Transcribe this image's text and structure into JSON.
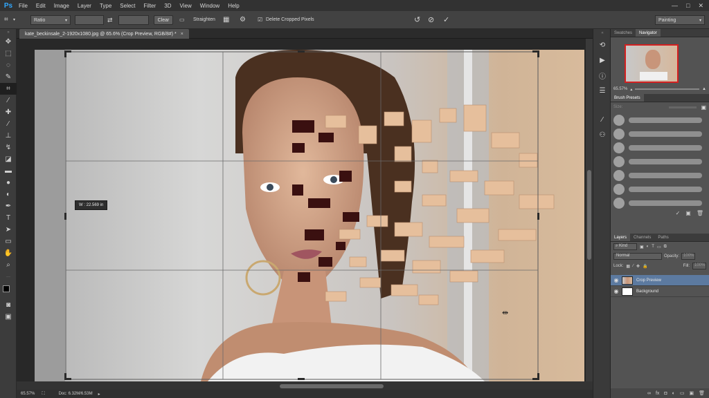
{
  "app": {
    "logo": "Ps"
  },
  "menu": [
    "File",
    "Edit",
    "Image",
    "Layer",
    "Type",
    "Select",
    "Filter",
    "3D",
    "View",
    "Window",
    "Help"
  ],
  "window_controls": {
    "minimize": "—",
    "maximize": "□",
    "close": "✕"
  },
  "options": {
    "ratio_select": "Ratio",
    "width_value": "",
    "height_value": "",
    "clear_label": "Clear",
    "straighten_label": "Straighten",
    "delete_cropped_label": "Delete Cropped Pixels",
    "delete_cropped_checked": true,
    "workspace_select": "Painting"
  },
  "document": {
    "tab_title": "kate_beckinsale_2-1920x1080.jpg @ 65.6% (Crop Preview, RGB/8#) *",
    "tab_close": "×",
    "tooltip": "W : 22.569 in"
  },
  "status": {
    "zoom": "65.57%",
    "doc": "Doc: 6.32M/6.53M"
  },
  "panels": {
    "top_tabs": [
      "Swatches",
      "Navigator"
    ],
    "nav_zoom": "65.57%",
    "brush_title": "Brush Presets",
    "brush_size_label": "Size:",
    "layers_tabs": [
      "Layers",
      "Channels",
      "Paths"
    ],
    "kind_label": "Kind",
    "blend_mode": "Normal",
    "opacity_label": "Opacity:",
    "opacity_value": "100%",
    "lock_label": "Lock:",
    "fill_label": "Fill:",
    "fill_value": "100%",
    "layers": [
      {
        "name": "Crop Preview",
        "selected": true,
        "visible": true
      },
      {
        "name": "Background",
        "selected": false,
        "visible": true
      }
    ]
  },
  "colors": {
    "accent": "#31a8ff",
    "selected_layer": "#5c7aa0"
  }
}
